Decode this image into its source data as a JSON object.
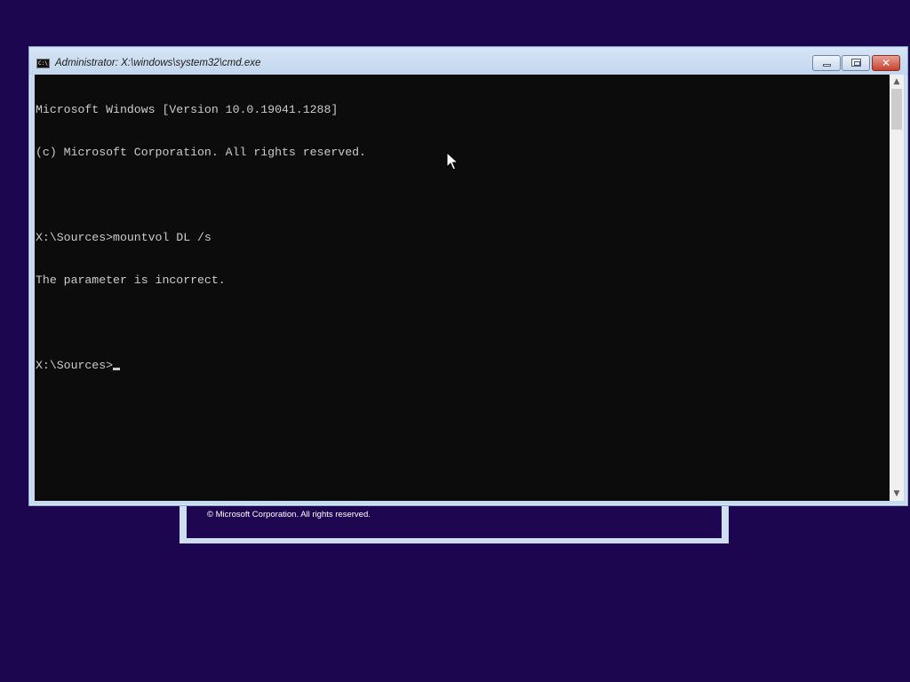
{
  "window": {
    "title": "Administrator: X:\\windows\\system32\\cmd.exe",
    "icon": "cmd-icon",
    "icon_text": "C:\\"
  },
  "console": {
    "lines": [
      "Microsoft Windows [Version 10.0.19041.1288]",
      "(c) Microsoft Corporation. All rights reserved.",
      "",
      "X:\\Sources>mountvol DL /s",
      "The parameter is incorrect.",
      ""
    ],
    "prompt": "X:\\Sources>",
    "background_color": "#0c0c0c",
    "text_color": "#cccccc"
  },
  "background_dialog": {
    "copyright": "© Microsoft Corporation. All rights reserved."
  },
  "icons": {
    "minimize": "minimize-icon",
    "maximize": "maximize-icon",
    "close": "close-icon",
    "scroll_up": "chevron-up-icon",
    "scroll_down": "chevron-down-icon",
    "pointer": "mouse-pointer-icon"
  },
  "colors": {
    "desktop": "#1d0650",
    "close_button": "#c7412f",
    "title_bar": "#c7daf0"
  }
}
